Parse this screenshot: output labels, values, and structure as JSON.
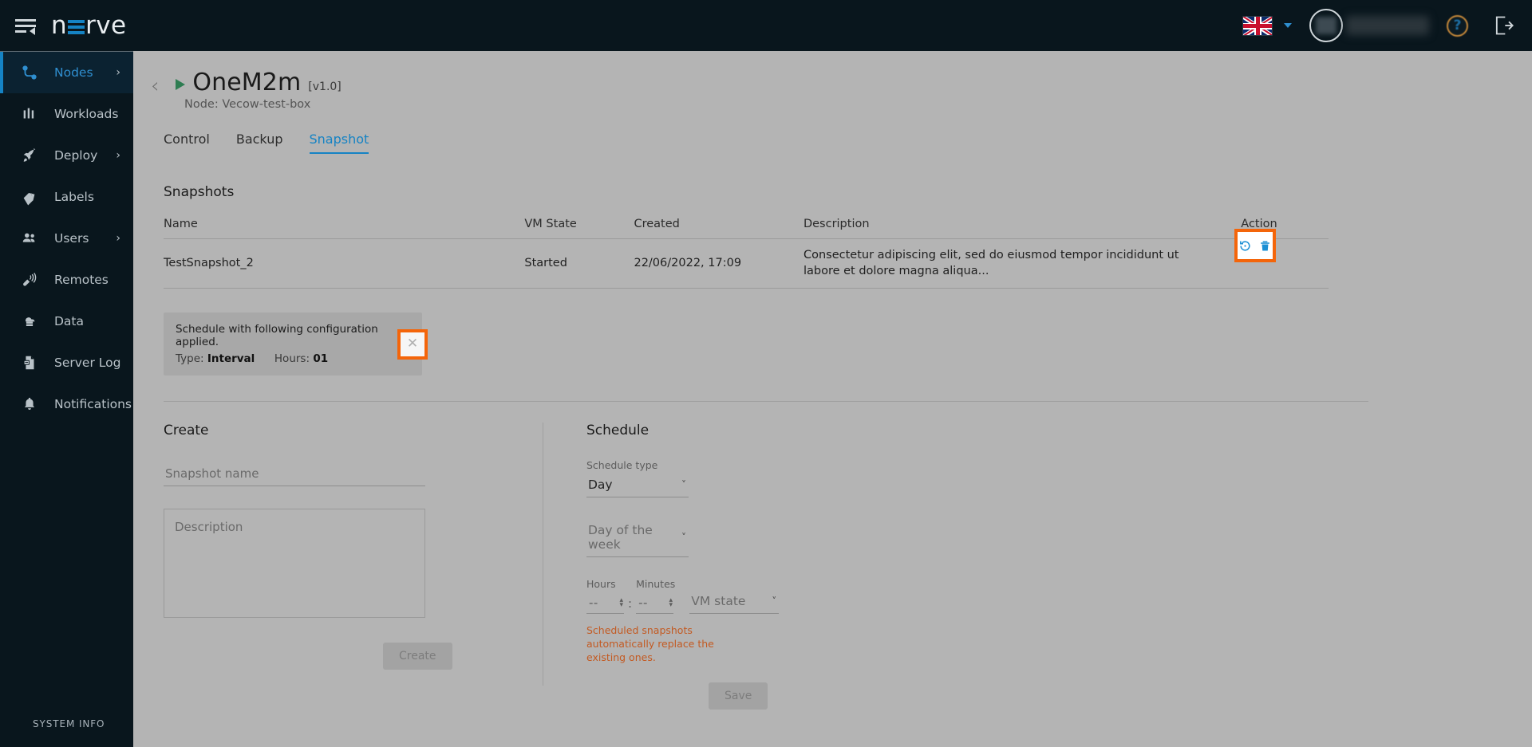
{
  "topbar": {
    "menu_icon": "hamburger-collapse-icon",
    "logo_text_pre": "n",
    "logo_e": "E",
    "logo_text_post": "rve",
    "language_flag": "uk-flag-icon",
    "language_caret": "chevron-down-icon",
    "avatar": "user-avatar",
    "username": "",
    "help_icon": "question-mark-icon",
    "logout_icon": "logout-icon"
  },
  "sidebar": {
    "items": [
      {
        "label": "Nodes",
        "icon": "nodes-icon",
        "active": true,
        "chevron": "›"
      },
      {
        "label": "Workloads",
        "icon": "workloads-icon",
        "active": false,
        "chevron": ""
      },
      {
        "label": "Deploy",
        "icon": "deploy-icon",
        "active": false,
        "chevron": "›"
      },
      {
        "label": "Labels",
        "icon": "labels-icon",
        "active": false,
        "chevron": ""
      },
      {
        "label": "Users",
        "icon": "users-icon",
        "active": false,
        "chevron": "›"
      },
      {
        "label": "Remotes",
        "icon": "remotes-icon",
        "active": false,
        "chevron": ""
      },
      {
        "label": "Data",
        "icon": "data-cloud-icon",
        "active": false,
        "chevron": ""
      },
      {
        "label": "Server Log",
        "icon": "server-log-icon",
        "active": false,
        "chevron": ""
      },
      {
        "label": "Notifications",
        "icon": "bell-icon",
        "active": false,
        "chevron": ""
      }
    ],
    "system_info": "SYSTEM INFO"
  },
  "page": {
    "back_chevron": "‹",
    "title": "OneM2m",
    "version": "[v1.0]",
    "node_line": "Node: Vecow-test-box",
    "status_icon": "running-play-icon"
  },
  "tabs": [
    {
      "label": "Control",
      "active": false
    },
    {
      "label": "Backup",
      "active": false
    },
    {
      "label": "Snapshot",
      "active": true
    }
  ],
  "snapshots": {
    "section_title": "Snapshots",
    "columns": [
      "Name",
      "VM State",
      "Created",
      "Description",
      "Action"
    ],
    "rows": [
      {
        "name": "TestSnapshot_2",
        "vm_state": "Started",
        "created": "22/06/2022, 17:09",
        "description": "Consectetur adipiscing elit, sed do eiusmod tempor incididunt ut labore et dolore magna aliqua...",
        "actions": [
          "restore-icon",
          "delete-icon"
        ]
      }
    ],
    "action_highlight_color": "#f4650a",
    "action_icon_color": "#1b8fd4"
  },
  "banner": {
    "line1": "Schedule with following configuration applied.",
    "type_label": "Type:",
    "type_value": "Interval",
    "hours_label": "Hours:",
    "hours_value": "01",
    "close_icon": "close-icon",
    "highlight_color": "#f4650a"
  },
  "create": {
    "heading": "Create",
    "name_placeholder": "Snapshot name",
    "name_value": "",
    "description_placeholder": "Description",
    "description_value": "",
    "button_label": "Create",
    "button_disabled": true
  },
  "schedule": {
    "heading": "Schedule",
    "type_label": "Schedule type",
    "type_value": "Day",
    "day_of_week_placeholder": "Day of the week",
    "day_of_week_value": "",
    "hours_label": "Hours",
    "hours_value": "--",
    "minutes_label": "Minutes",
    "minutes_value": "--",
    "colon": ":",
    "vm_state_placeholder": "VM state",
    "vm_state_value": "",
    "warning": "Scheduled snapshots automatically replace the existing ones.",
    "warning_color": "#c35a22",
    "button_label": "Save",
    "button_disabled": true
  }
}
